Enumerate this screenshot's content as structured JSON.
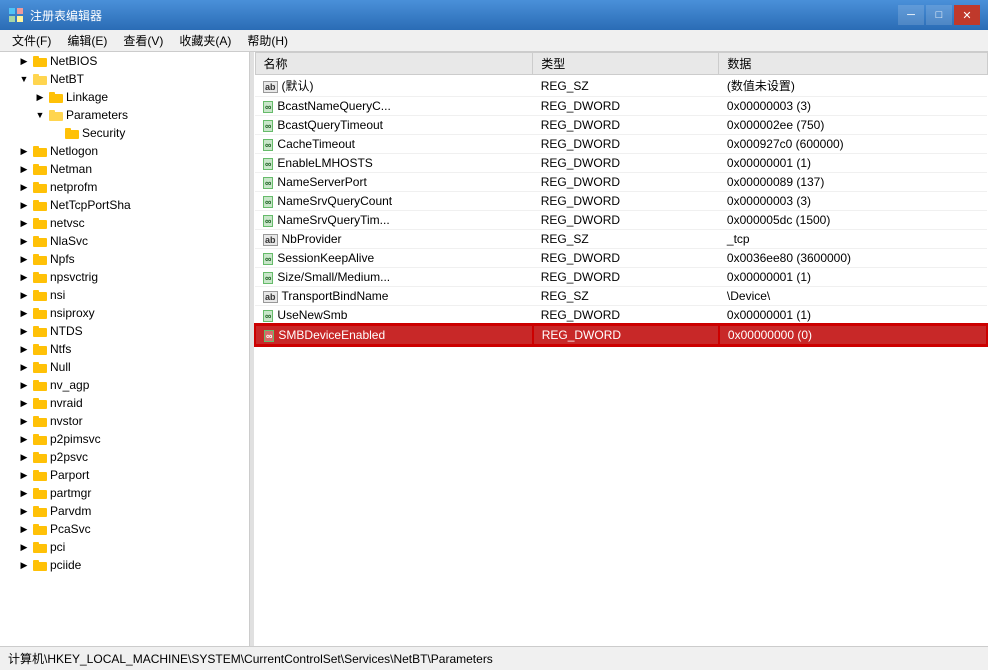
{
  "titleBar": {
    "title": "注册表编辑器",
    "icon": "regedit-icon",
    "minimizeLabel": "─",
    "maximizeLabel": "□",
    "closeLabel": "✕"
  },
  "menuBar": {
    "items": [
      {
        "id": "file",
        "label": "文件(F)"
      },
      {
        "id": "edit",
        "label": "编辑(E)"
      },
      {
        "id": "view",
        "label": "查看(V)"
      },
      {
        "id": "favorites",
        "label": "收藏夹(A)"
      },
      {
        "id": "help",
        "label": "帮助(H)"
      }
    ]
  },
  "treePane": {
    "items": [
      {
        "id": "netbios",
        "label": "NetBIOS",
        "indent": 1,
        "expanded": false,
        "hasChildren": true
      },
      {
        "id": "netbt",
        "label": "NetBT",
        "indent": 1,
        "expanded": true,
        "hasChildren": true,
        "selected": false
      },
      {
        "id": "linkage",
        "label": "Linkage",
        "indent": 2,
        "expanded": false,
        "hasChildren": true
      },
      {
        "id": "parameters",
        "label": "Parameters",
        "indent": 2,
        "expanded": true,
        "hasChildren": true
      },
      {
        "id": "security",
        "label": "Security",
        "indent": 3,
        "expanded": false,
        "hasChildren": false,
        "selected": false
      },
      {
        "id": "netlogon",
        "label": "Netlogon",
        "indent": 1,
        "expanded": false,
        "hasChildren": true
      },
      {
        "id": "netman",
        "label": "Netman",
        "indent": 1,
        "expanded": false,
        "hasChildren": true
      },
      {
        "id": "netprofm",
        "label": "netprofm",
        "indent": 1,
        "expanded": false,
        "hasChildren": true
      },
      {
        "id": "nettcpportsha",
        "label": "NetTcpPortSha",
        "indent": 1,
        "expanded": false,
        "hasChildren": true
      },
      {
        "id": "netvsc",
        "label": "netvsc",
        "indent": 1,
        "expanded": false,
        "hasChildren": true
      },
      {
        "id": "nlasvc",
        "label": "NlaSvc",
        "indent": 1,
        "expanded": false,
        "hasChildren": true
      },
      {
        "id": "npfs",
        "label": "Npfs",
        "indent": 1,
        "expanded": false,
        "hasChildren": true
      },
      {
        "id": "npsvctrg",
        "label": "npsvctrig",
        "indent": 1,
        "expanded": false,
        "hasChildren": true
      },
      {
        "id": "nsi",
        "label": "nsi",
        "indent": 1,
        "expanded": false,
        "hasChildren": true
      },
      {
        "id": "nsiproxy",
        "label": "nsiproxy",
        "indent": 1,
        "expanded": false,
        "hasChildren": true
      },
      {
        "id": "ntds",
        "label": "NTDS",
        "indent": 1,
        "expanded": false,
        "hasChildren": true
      },
      {
        "id": "ntfs",
        "label": "Ntfs",
        "indent": 1,
        "expanded": false,
        "hasChildren": true
      },
      {
        "id": "null",
        "label": "Null",
        "indent": 1,
        "expanded": false,
        "hasChildren": true
      },
      {
        "id": "nv_agp",
        "label": "nv_agp",
        "indent": 1,
        "expanded": false,
        "hasChildren": true
      },
      {
        "id": "nvraid",
        "label": "nvraid",
        "indent": 1,
        "expanded": false,
        "hasChildren": true
      },
      {
        "id": "nvstor",
        "label": "nvstor",
        "indent": 1,
        "expanded": false,
        "hasChildren": true
      },
      {
        "id": "p2pimsvc",
        "label": "p2pimsvc",
        "indent": 1,
        "expanded": false,
        "hasChildren": true
      },
      {
        "id": "p2psvc",
        "label": "p2psvc",
        "indent": 1,
        "expanded": false,
        "hasChildren": true
      },
      {
        "id": "parport",
        "label": "Parport",
        "indent": 1,
        "expanded": false,
        "hasChildren": true
      },
      {
        "id": "partmgr",
        "label": "partmgr",
        "indent": 1,
        "expanded": false,
        "hasChildren": true
      },
      {
        "id": "parvdm",
        "label": "Parvdm",
        "indent": 1,
        "expanded": false,
        "hasChildren": true
      },
      {
        "id": "pcasvc",
        "label": "PcaSvc",
        "indent": 1,
        "expanded": false,
        "hasChildren": true
      },
      {
        "id": "pci",
        "label": "pci",
        "indent": 1,
        "expanded": false,
        "hasChildren": true
      },
      {
        "id": "pciide",
        "label": "pciide",
        "indent": 1,
        "expanded": false,
        "hasChildren": true
      }
    ]
  },
  "registryTable": {
    "columns": [
      "名称",
      "类型",
      "数据"
    ],
    "rows": [
      {
        "id": "default",
        "name": "(默认)",
        "type": "REG_SZ",
        "data": "(数值未设置)",
        "iconType": "ab",
        "selected": false
      },
      {
        "id": "bcastnamequery",
        "name": "BcastNameQueryC...",
        "type": "REG_DWORD",
        "data": "0x00000003 (3)",
        "iconType": "dword",
        "selected": false
      },
      {
        "id": "bcastquerytimeout",
        "name": "BcastQueryTimeout",
        "type": "REG_DWORD",
        "data": "0x000002ee (750)",
        "iconType": "dword",
        "selected": false
      },
      {
        "id": "cachetimeout",
        "name": "CacheTimeout",
        "type": "REG_DWORD",
        "data": "0x000927c0 (600000)",
        "iconType": "dword",
        "selected": false
      },
      {
        "id": "enablelmhosts",
        "name": "EnableLMHOSTS",
        "type": "REG_DWORD",
        "data": "0x00000001 (1)",
        "iconType": "dword",
        "selected": false
      },
      {
        "id": "nameserverport",
        "name": "NameServerPort",
        "type": "REG_DWORD",
        "data": "0x00000089 (137)",
        "iconType": "dword",
        "selected": false
      },
      {
        "id": "namesrvquerycount",
        "name": "NameSrvQueryCount",
        "type": "REG_DWORD",
        "data": "0x00000003 (3)",
        "iconType": "dword",
        "selected": false
      },
      {
        "id": "namesrvquerytim",
        "name": "NameSrvQueryTim...",
        "type": "REG_DWORD",
        "data": "0x000005dc (1500)",
        "iconType": "dword",
        "selected": false
      },
      {
        "id": "nbprovider",
        "name": "NbProvider",
        "type": "REG_SZ",
        "data": "_tcp",
        "iconType": "ab",
        "selected": false
      },
      {
        "id": "sessionkeepalive",
        "name": "SessionKeepAlive",
        "type": "REG_DWORD",
        "data": "0x0036ee80 (3600000)",
        "iconType": "dword",
        "selected": false
      },
      {
        "id": "sizesmall",
        "name": "Size/Small/Medium...",
        "type": "REG_DWORD",
        "data": "0x00000001 (1)",
        "iconType": "dword",
        "selected": false
      },
      {
        "id": "transportbindname",
        "name": "TransportBindName",
        "type": "REG_SZ",
        "data": "\\Device\\",
        "iconType": "ab",
        "selected": false
      },
      {
        "id": "usenewsmb",
        "name": "UseNewSmb",
        "type": "REG_DWORD",
        "data": "0x00000001 (1)",
        "iconType": "dword",
        "selected": false
      },
      {
        "id": "smbdeviceenabled",
        "name": "SMBDeviceEnabled",
        "type": "REG_DWORD",
        "data": "0x00000000 (0)",
        "iconType": "dword",
        "selected": true
      }
    ]
  },
  "statusBar": {
    "text": "计算机\\HKEY_LOCAL_MACHINE\\SYSTEM\\CurrentControlSet\\Services\\NetBT\\Parameters"
  }
}
